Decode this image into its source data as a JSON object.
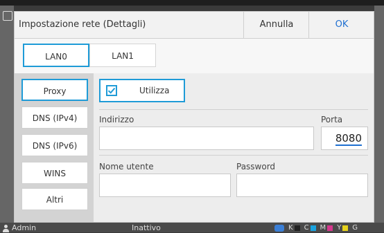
{
  "dialog": {
    "title": "Impostazione rete (Dettagli)",
    "cancel_label": "Annulla",
    "ok_label": "OK"
  },
  "tabs": [
    {
      "label": "LAN0",
      "selected": true
    },
    {
      "label": "LAN1",
      "selected": false
    }
  ],
  "nav": [
    {
      "label": "Proxy",
      "selected": true
    },
    {
      "label": "DNS (IPv4)",
      "selected": false
    },
    {
      "label": "DNS (IPv6)",
      "selected": false
    },
    {
      "label": "WINS",
      "selected": false
    },
    {
      "label": "Altri",
      "selected": false
    }
  ],
  "proxy": {
    "use_label": "Utilizza",
    "use_checked": true,
    "address_label": "Indirizzo",
    "address_value": "",
    "port_label": "Porta",
    "port_value": "8080",
    "username_label": "Nome utente",
    "username_value": "",
    "password_label": "Password",
    "password_value": ""
  },
  "status_bar": {
    "user": "Admin",
    "state": "Inattivo",
    "inks": [
      {
        "letter": "K",
        "color": "#222222"
      },
      {
        "letter": "C",
        "color": "#1aa3e0"
      },
      {
        "letter": "M",
        "color": "#d6388e"
      },
      {
        "letter": "Y",
        "color": "#e6d21c"
      },
      {
        "letter": "G",
        "color": "#888888"
      }
    ]
  },
  "colors": {
    "accent": "#1e9bd7",
    "ok_text": "#1f6fd1"
  }
}
